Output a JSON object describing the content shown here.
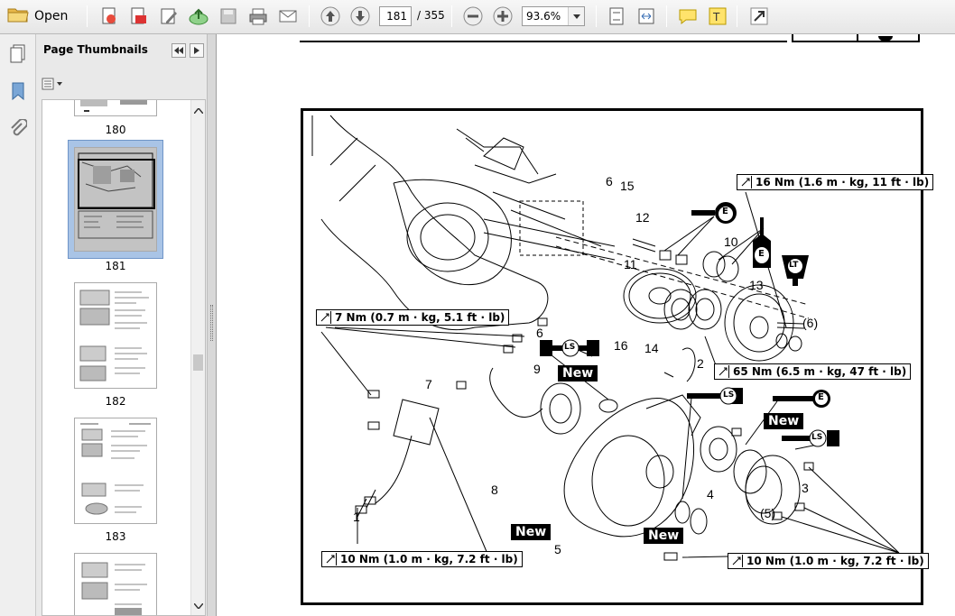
{
  "toolbar": {
    "open_label": "Open",
    "page_current": "181",
    "page_total": "/ 355",
    "zoom": "93.6%"
  },
  "thumbnails_panel": {
    "title": "Page Thumbnails",
    "pages": [
      "180",
      "181",
      "182",
      "183"
    ],
    "selected": "181"
  },
  "diagram": {
    "torque_labels": {
      "t16": "16 Nm (1.6 m · kg, 11 ft · lb)",
      "t7": "7 Nm (0.7 m · kg, 5.1 ft · lb)",
      "t65": "65 Nm (6.5 m · kg, 47 ft · lb)",
      "t10a": "10 Nm (1.0 m · kg, 7.2 ft · lb)",
      "t10b": "10 Nm (1.0 m · kg, 7.2 ft · lb)"
    },
    "new_label": "New",
    "lubricant_labels": {
      "engine_oil": "E",
      "lithium_soap": "LS",
      "locktite": "LT"
    },
    "part_numbers": {
      "n1": "1",
      "n2": "2",
      "n3": "3",
      "n4": "4",
      "n5": "5",
      "n6a": "6",
      "n6b": "6",
      "n6c": "(6)",
      "n5b": "(5)",
      "n7": "7",
      "n8": "8",
      "n9": "9",
      "n10": "10",
      "n11": "11",
      "n12": "12",
      "n13": "13",
      "n14": "14",
      "n15": "15",
      "n16": "16"
    }
  }
}
